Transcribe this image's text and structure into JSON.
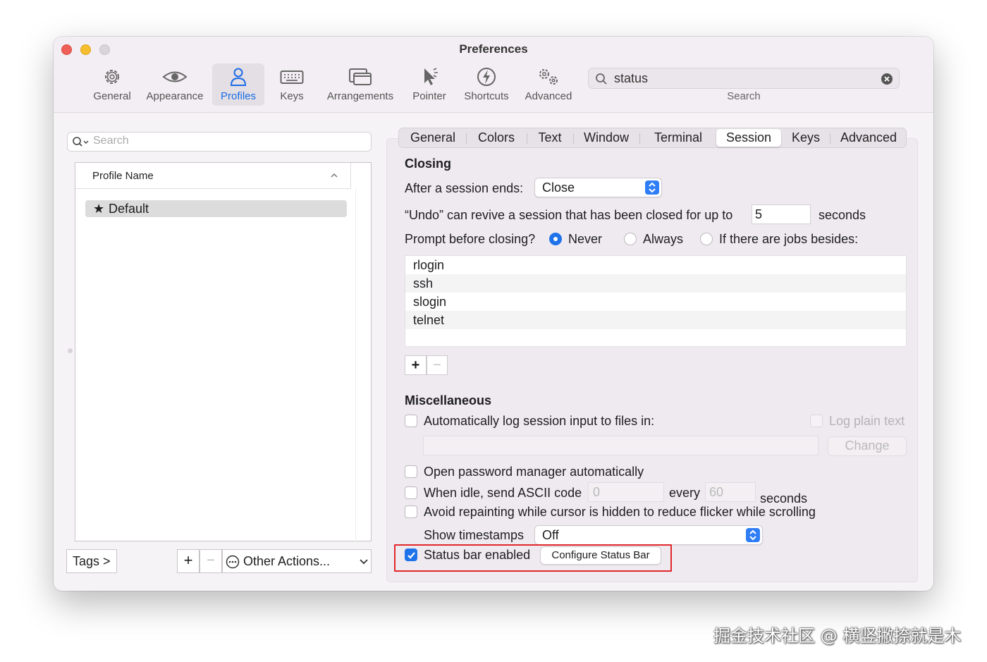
{
  "window": {
    "title": "Preferences"
  },
  "toolbar": {
    "items": [
      {
        "label": "General",
        "icon": "gear-icon"
      },
      {
        "label": "Appearance",
        "icon": "eye-icon"
      },
      {
        "label": "Profiles",
        "icon": "person-icon",
        "active": true
      },
      {
        "label": "Keys",
        "icon": "keyboard-icon"
      },
      {
        "label": "Arrangements",
        "icon": "windows-icon"
      },
      {
        "label": "Pointer",
        "icon": "pointer-icon"
      },
      {
        "label": "Shortcuts",
        "icon": "bolt-icon"
      },
      {
        "label": "Advanced",
        "icon": "gears-icon"
      }
    ],
    "search": {
      "value": "status",
      "caption": "Search"
    }
  },
  "profiles": {
    "search_placeholder": "Search",
    "column_header": "Profile Name",
    "items": [
      {
        "name": "Default",
        "default": true
      }
    ],
    "tags_button": "Tags >",
    "other_actions": "Other Actions..."
  },
  "tabs": [
    "General",
    "Colors",
    "Text",
    "Window",
    "Terminal",
    "Session",
    "Keys",
    "Advanced"
  ],
  "active_tab": "Session",
  "closing": {
    "heading": "Closing",
    "session_ends_label": "After a session ends:",
    "session_ends_value": "Close",
    "undo_label": "“Undo” can revive a session that has been closed for up to",
    "undo_value": "5",
    "undo_unit": "seconds",
    "prompt_label": "Prompt before closing?",
    "prompt_options": [
      "Never",
      "Always",
      "If there are jobs besides:"
    ],
    "prompt_selected": "Never",
    "jobs": [
      "rlogin",
      "ssh",
      "slogin",
      "telnet"
    ]
  },
  "misc": {
    "heading": "Miscellaneous",
    "auto_log_label": "Automatically log session input to files in:",
    "log_plain_text": "Log plain text",
    "change_button": "Change",
    "password_manager_label": "Open password manager automatically",
    "idle_label": "When idle, send ASCII code",
    "idle_code": "0",
    "idle_every": "every",
    "idle_seconds_value": "60",
    "idle_seconds": "seconds",
    "avoid_repaint_label": "Avoid repainting while cursor is hidden to reduce flicker while scrolling",
    "timestamps_label": "Show timestamps",
    "timestamps_value": "Off",
    "status_bar_label": "Status bar enabled",
    "status_bar_enabled": true,
    "configure_button": "Configure Status Bar"
  },
  "colors": {
    "accent": "#1f73ea",
    "highlight": "#e0282c"
  },
  "watermark": "掘金技术社区 @ 横竖撇捺就是木"
}
